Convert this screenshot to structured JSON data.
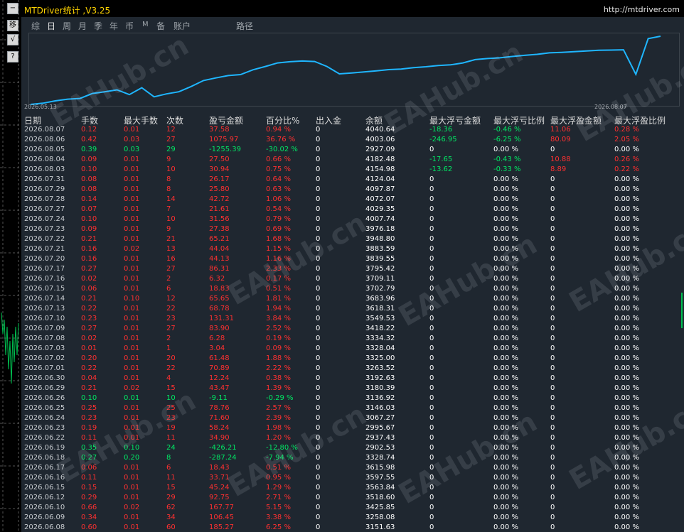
{
  "window": {
    "title": "MTDriver统计 ,V3.25",
    "url": "http://mtdriver.com"
  },
  "side_buttons": [
    "−",
    "移",
    "√",
    "?"
  ],
  "tabs": [
    {
      "label": "综",
      "active": false
    },
    {
      "label": "日",
      "active": true
    },
    {
      "label": "周",
      "active": false
    },
    {
      "label": "月",
      "active": false
    },
    {
      "label": "季",
      "active": false
    },
    {
      "label": "年",
      "active": false
    },
    {
      "label": "币",
      "active": false
    },
    {
      "label": "M",
      "active": false
    },
    {
      "label": "备",
      "active": false
    },
    {
      "label": "账户",
      "active": false
    },
    {
      "label": "路径",
      "active": false
    }
  ],
  "chart_data": {
    "type": "line",
    "x_start_label": "2026.05.13",
    "x_end_label": "2026.08.07",
    "series_color": "#1fb6ff",
    "values": [
      2920,
      2945,
      2995,
      3030,
      3045,
      3150,
      3185,
      3225,
      3125,
      3270,
      3080,
      3140,
      3185,
      3295,
      3420,
      3475,
      3525,
      3545,
      3645,
      3715,
      3790,
      3815,
      3830,
      3820,
      3715,
      3560,
      3580,
      3600,
      3625,
      3650,
      3662,
      3690,
      3710,
      3735,
      3750,
      3790,
      3860,
      3882,
      3897,
      3925,
      3950,
      3970,
      4001,
      4012,
      4025,
      4040,
      4055,
      4060,
      4065,
      3550,
      4300,
      4350
    ]
  },
  "headers": [
    "日期",
    "手数",
    "最大手数",
    "次数",
    "盈亏金额",
    "百分比%",
    "出入金",
    "余额",
    "最大浮亏金额",
    "最大浮亏比例",
    "最大浮盈金额",
    "最大浮盈比例"
  ],
  "rows": [
    {
      "date": "2026.08.07",
      "lots": "0.12",
      "max_lots": "0.01",
      "count": "12",
      "pl": "37.58",
      "pct": "0.94 %",
      "io": "0",
      "bal": "4040.64",
      "fl_amt": "-18.36",
      "fl_pct": "-0.46 %",
      "fp_amt": "11.06",
      "fp_pct": "0.28 %"
    },
    {
      "date": "2026.08.06",
      "lots": "0.42",
      "max_lots": "0.03",
      "count": "27",
      "pl": "1075.97",
      "pct": "36.76 %",
      "io": "0",
      "bal": "4003.06",
      "fl_amt": "-246.95",
      "fl_pct": "-6.25 %",
      "fp_amt": "80.09",
      "fp_pct": "2.05 %"
    },
    {
      "date": "2026.08.05",
      "lots": "0.39",
      "max_lots": "0.03",
      "count": "29",
      "pl": "-1255.39",
      "pct": "-30.02 %",
      "io": "0",
      "bal": "2927.09",
      "fl_amt": "0",
      "fl_pct": "0.00 %",
      "fp_amt": "0",
      "fp_pct": "0.00 %"
    },
    {
      "date": "2026.08.04",
      "lots": "0.09",
      "max_lots": "0.01",
      "count": "9",
      "pl": "27.50",
      "pct": "0.66 %",
      "io": "0",
      "bal": "4182.48",
      "fl_amt": "-17.65",
      "fl_pct": "-0.43 %",
      "fp_amt": "10.88",
      "fp_pct": "0.26 %"
    },
    {
      "date": "2026.08.03",
      "lots": "0.10",
      "max_lots": "0.01",
      "count": "10",
      "pl": "30.94",
      "pct": "0.75 %",
      "io": "0",
      "bal": "4154.98",
      "fl_amt": "-13.62",
      "fl_pct": "-0.33 %",
      "fp_amt": "8.89",
      "fp_pct": "0.22 %"
    },
    {
      "date": "2026.07.31",
      "lots": "0.08",
      "max_lots": "0.01",
      "count": "8",
      "pl": "26.17",
      "pct": "0.64 %",
      "io": "0",
      "bal": "4124.04",
      "fl_amt": "0",
      "fl_pct": "0.00 %",
      "fp_amt": "0",
      "fp_pct": "0.00 %"
    },
    {
      "date": "2026.07.29",
      "lots": "0.08",
      "max_lots": "0.01",
      "count": "8",
      "pl": "25.80",
      "pct": "0.63 %",
      "io": "0",
      "bal": "4097.87",
      "fl_amt": "0",
      "fl_pct": "0.00 %",
      "fp_amt": "0",
      "fp_pct": "0.00 %"
    },
    {
      "date": "2026.07.28",
      "lots": "0.14",
      "max_lots": "0.01",
      "count": "14",
      "pl": "42.72",
      "pct": "1.06 %",
      "io": "0",
      "bal": "4072.07",
      "fl_amt": "0",
      "fl_pct": "0.00 %",
      "fp_amt": "0",
      "fp_pct": "0.00 %"
    },
    {
      "date": "2026.07.27",
      "lots": "0.07",
      "max_lots": "0.01",
      "count": "7",
      "pl": "21.61",
      "pct": "0.54 %",
      "io": "0",
      "bal": "4029.35",
      "fl_amt": "0",
      "fl_pct": "0.00 %",
      "fp_amt": "0",
      "fp_pct": "0.00 %"
    },
    {
      "date": "2026.07.24",
      "lots": "0.10",
      "max_lots": "0.01",
      "count": "10",
      "pl": "31.56",
      "pct": "0.79 %",
      "io": "0",
      "bal": "4007.74",
      "fl_amt": "0",
      "fl_pct": "0.00 %",
      "fp_amt": "0",
      "fp_pct": "0.00 %"
    },
    {
      "date": "2026.07.23",
      "lots": "0.09",
      "max_lots": "0.01",
      "count": "9",
      "pl": "27.38",
      "pct": "0.69 %",
      "io": "0",
      "bal": "3976.18",
      "fl_amt": "0",
      "fl_pct": "0.00 %",
      "fp_amt": "0",
      "fp_pct": "0.00 %"
    },
    {
      "date": "2026.07.22",
      "lots": "0.21",
      "max_lots": "0.01",
      "count": "21",
      "pl": "65.21",
      "pct": "1.68 %",
      "io": "0",
      "bal": "3948.80",
      "fl_amt": "0",
      "fl_pct": "0.00 %",
      "fp_amt": "0",
      "fp_pct": "0.00 %"
    },
    {
      "date": "2026.07.21",
      "lots": "0.16",
      "max_lots": "0.02",
      "count": "13",
      "pl": "44.04",
      "pct": "1.15 %",
      "io": "0",
      "bal": "3883.59",
      "fl_amt": "0",
      "fl_pct": "0.00 %",
      "fp_amt": "0",
      "fp_pct": "0.00 %"
    },
    {
      "date": "2026.07.20",
      "lots": "0.16",
      "max_lots": "0.01",
      "count": "16",
      "pl": "44.13",
      "pct": "1.16 %",
      "io": "0",
      "bal": "3839.55",
      "fl_amt": "0",
      "fl_pct": "0.00 %",
      "fp_amt": "0",
      "fp_pct": "0.00 %"
    },
    {
      "date": "2026.07.17",
      "lots": "0.27",
      "max_lots": "0.01",
      "count": "27",
      "pl": "86.31",
      "pct": "2.33 %",
      "io": "0",
      "bal": "3795.42",
      "fl_amt": "0",
      "fl_pct": "0.00 %",
      "fp_amt": "0",
      "fp_pct": "0.00 %"
    },
    {
      "date": "2026.07.16",
      "lots": "0.02",
      "max_lots": "0.01",
      "count": "2",
      "pl": "6.32",
      "pct": "0.17 %",
      "io": "0",
      "bal": "3709.11",
      "fl_amt": "0",
      "fl_pct": "0.00 %",
      "fp_amt": "0",
      "fp_pct": "0.00 %"
    },
    {
      "date": "2026.07.15",
      "lots": "0.06",
      "max_lots": "0.01",
      "count": "6",
      "pl": "18.83",
      "pct": "0.51 %",
      "io": "0",
      "bal": "3702.79",
      "fl_amt": "0",
      "fl_pct": "0.00 %",
      "fp_amt": "0",
      "fp_pct": "0.00 %"
    },
    {
      "date": "2026.07.14",
      "lots": "0.21",
      "max_lots": "0.10",
      "count": "12",
      "pl": "65.65",
      "pct": "1.81 %",
      "io": "0",
      "bal": "3683.96",
      "fl_amt": "0",
      "fl_pct": "0.00 %",
      "fp_amt": "0",
      "fp_pct": "0.00 %"
    },
    {
      "date": "2026.07.13",
      "lots": "0.22",
      "max_lots": "0.01",
      "count": "22",
      "pl": "68.78",
      "pct": "1.94 %",
      "io": "0",
      "bal": "3618.31",
      "fl_amt": "0",
      "fl_pct": "0.00 %",
      "fp_amt": "0",
      "fp_pct": "0.00 %"
    },
    {
      "date": "2026.07.10",
      "lots": "0.23",
      "max_lots": "0.01",
      "count": "23",
      "pl": "131.31",
      "pct": "3.84 %",
      "io": "0",
      "bal": "3549.53",
      "fl_amt": "0",
      "fl_pct": "0.00 %",
      "fp_amt": "0",
      "fp_pct": "0.00 %"
    },
    {
      "date": "2026.07.09",
      "lots": "0.27",
      "max_lots": "0.01",
      "count": "27",
      "pl": "83.90",
      "pct": "2.52 %",
      "io": "0",
      "bal": "3418.22",
      "fl_amt": "0",
      "fl_pct": "0.00 %",
      "fp_amt": "0",
      "fp_pct": "0.00 %"
    },
    {
      "date": "2026.07.08",
      "lots": "0.02",
      "max_lots": "0.01",
      "count": "2",
      "pl": "6.28",
      "pct": "0.19 %",
      "io": "0",
      "bal": "3334.32",
      "fl_amt": "0",
      "fl_pct": "0.00 %",
      "fp_amt": "0",
      "fp_pct": "0.00 %"
    },
    {
      "date": "2026.07.03",
      "lots": "0.01",
      "max_lots": "0.01",
      "count": "1",
      "pl": "3.04",
      "pct": "0.09 %",
      "io": "0",
      "bal": "3328.04",
      "fl_amt": "0",
      "fl_pct": "0.00 %",
      "fp_amt": "0",
      "fp_pct": "0.00 %"
    },
    {
      "date": "2026.07.02",
      "lots": "0.20",
      "max_lots": "0.01",
      "count": "20",
      "pl": "61.48",
      "pct": "1.88 %",
      "io": "0",
      "bal": "3325.00",
      "fl_amt": "0",
      "fl_pct": "0.00 %",
      "fp_amt": "0",
      "fp_pct": "0.00 %"
    },
    {
      "date": "2026.07.01",
      "lots": "0.22",
      "max_lots": "0.01",
      "count": "22",
      "pl": "70.89",
      "pct": "2.22 %",
      "io": "0",
      "bal": "3263.52",
      "fl_amt": "0",
      "fl_pct": "0.00 %",
      "fp_amt": "0",
      "fp_pct": "0.00 %"
    },
    {
      "date": "2026.06.30",
      "lots": "0.04",
      "max_lots": "0.01",
      "count": "4",
      "pl": "12.24",
      "pct": "0.38 %",
      "io": "0",
      "bal": "3192.63",
      "fl_amt": "0",
      "fl_pct": "0.00 %",
      "fp_amt": "0",
      "fp_pct": "0.00 %"
    },
    {
      "date": "2026.06.29",
      "lots": "0.21",
      "max_lots": "0.02",
      "count": "15",
      "pl": "43.47",
      "pct": "1.39 %",
      "io": "0",
      "bal": "3180.39",
      "fl_amt": "0",
      "fl_pct": "0.00 %",
      "fp_amt": "0",
      "fp_pct": "0.00 %"
    },
    {
      "date": "2026.06.26",
      "lots": "0.10",
      "max_lots": "0.01",
      "count": "10",
      "pl": "-9.11",
      "pct": "-0.29 %",
      "io": "0",
      "bal": "3136.92",
      "fl_amt": "0",
      "fl_pct": "0.00 %",
      "fp_amt": "0",
      "fp_pct": "0.00 %"
    },
    {
      "date": "2026.06.25",
      "lots": "0.25",
      "max_lots": "0.01",
      "count": "25",
      "pl": "78.76",
      "pct": "2.57 %",
      "io": "0",
      "bal": "3146.03",
      "fl_amt": "0",
      "fl_pct": "0.00 %",
      "fp_amt": "0",
      "fp_pct": "0.00 %"
    },
    {
      "date": "2026.06.24",
      "lots": "0.23",
      "max_lots": "0.01",
      "count": "23",
      "pl": "71.60",
      "pct": "2.39 %",
      "io": "0",
      "bal": "3067.27",
      "fl_amt": "0",
      "fl_pct": "0.00 %",
      "fp_amt": "0",
      "fp_pct": "0.00 %"
    },
    {
      "date": "2026.06.23",
      "lots": "0.19",
      "max_lots": "0.01",
      "count": "19",
      "pl": "58.24",
      "pct": "1.98 %",
      "io": "0",
      "bal": "2995.67",
      "fl_amt": "0",
      "fl_pct": "0.00 %",
      "fp_amt": "0",
      "fp_pct": "0.00 %"
    },
    {
      "date": "2026.06.22",
      "lots": "0.11",
      "max_lots": "0.01",
      "count": "11",
      "pl": "34.90",
      "pct": "1.20 %",
      "io": "0",
      "bal": "2937.43",
      "fl_amt": "0",
      "fl_pct": "0.00 %",
      "fp_amt": "0",
      "fp_pct": "0.00 %"
    },
    {
      "date": "2026.06.19",
      "lots": "0.35",
      "max_lots": "0.10",
      "count": "24",
      "pl": "-426.21",
      "pct": "-12.80 %",
      "io": "0",
      "bal": "2902.53",
      "fl_amt": "0",
      "fl_pct": "0.00 %",
      "fp_amt": "0",
      "fp_pct": "0.00 %"
    },
    {
      "date": "2026.06.18",
      "lots": "0.27",
      "max_lots": "0.20",
      "count": "8",
      "pl": "-287.24",
      "pct": "-7.94 %",
      "io": "0",
      "bal": "3328.74",
      "fl_amt": "0",
      "fl_pct": "0.00 %",
      "fp_amt": "0",
      "fp_pct": "0.00 %"
    },
    {
      "date": "2026.06.17",
      "lots": "0.06",
      "max_lots": "0.01",
      "count": "6",
      "pl": "18.43",
      "pct": "0.51 %",
      "io": "0",
      "bal": "3615.98",
      "fl_amt": "0",
      "fl_pct": "0.00 %",
      "fp_amt": "0",
      "fp_pct": "0.00 %"
    },
    {
      "date": "2026.06.16",
      "lots": "0.11",
      "max_lots": "0.01",
      "count": "11",
      "pl": "33.71",
      "pct": "0.95 %",
      "io": "0",
      "bal": "3597.55",
      "fl_amt": "0",
      "fl_pct": "0.00 %",
      "fp_amt": "0",
      "fp_pct": "0.00 %"
    },
    {
      "date": "2026.06.15",
      "lots": "0.15",
      "max_lots": "0.01",
      "count": "15",
      "pl": "45.24",
      "pct": "1.29 %",
      "io": "0",
      "bal": "3563.84",
      "fl_amt": "0",
      "fl_pct": "0.00 %",
      "fp_amt": "0",
      "fp_pct": "0.00 %"
    },
    {
      "date": "2026.06.12",
      "lots": "0.29",
      "max_lots": "0.01",
      "count": "29",
      "pl": "92.75",
      "pct": "2.71 %",
      "io": "0",
      "bal": "3518.60",
      "fl_amt": "0",
      "fl_pct": "0.00 %",
      "fp_amt": "0",
      "fp_pct": "0.00 %"
    },
    {
      "date": "2026.06.10",
      "lots": "0.66",
      "max_lots": "0.02",
      "count": "62",
      "pl": "167.77",
      "pct": "5.15 %",
      "io": "0",
      "bal": "3425.85",
      "fl_amt": "0",
      "fl_pct": "0.00 %",
      "fp_amt": "0",
      "fp_pct": "0.00 %"
    },
    {
      "date": "2026.06.09",
      "lots": "0.34",
      "max_lots": "0.01",
      "count": "34",
      "pl": "106.45",
      "pct": "3.38 %",
      "io": "0",
      "bal": "3258.08",
      "fl_amt": "0",
      "fl_pct": "0.00 %",
      "fp_amt": "0",
      "fp_pct": "0.00 %"
    },
    {
      "date": "2026.06.08",
      "lots": "0.60",
      "max_lots": "0.01",
      "count": "60",
      "pl": "185.27",
      "pct": "6.25 %",
      "io": "0",
      "bal": "3151.63",
      "fl_amt": "0",
      "fl_pct": "0.00 %",
      "fp_amt": "0",
      "fp_pct": "0.00 %"
    }
  ],
  "watermark": "EAHub.cn",
  "colors": {
    "positive": "#ff3030",
    "negative": "#00e864",
    "neutral": "#ffffff",
    "panel_bg": "#1f2730",
    "title": "#ffd400",
    "line": "#1fb6ff"
  }
}
